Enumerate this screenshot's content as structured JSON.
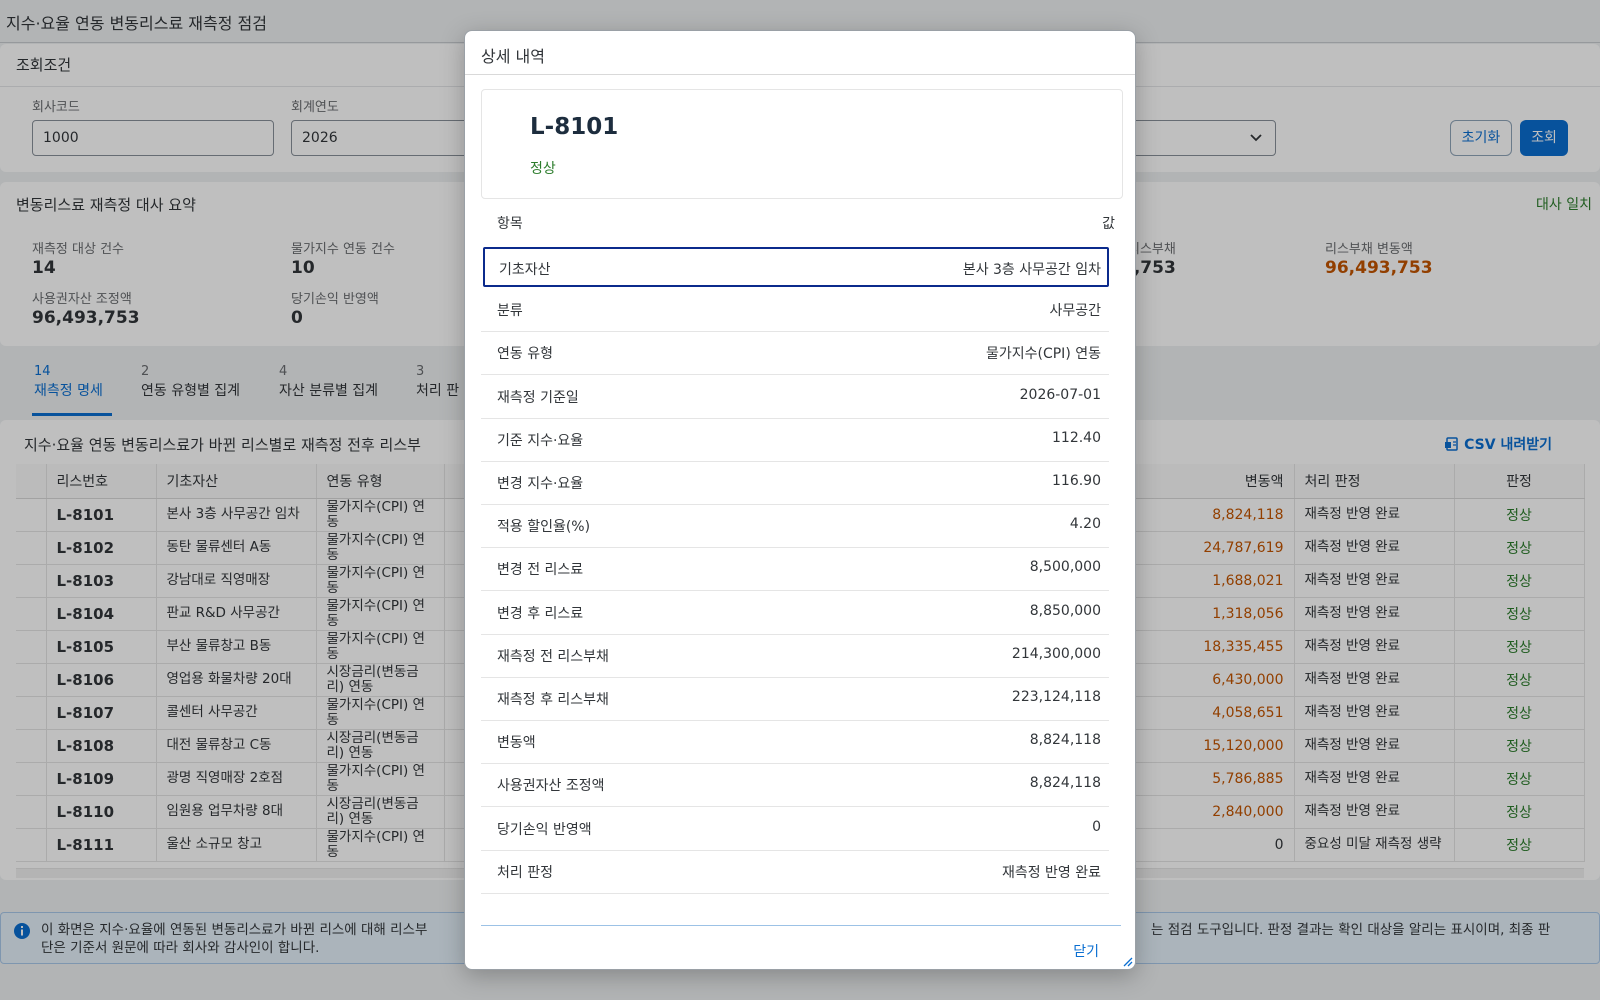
{
  "page": {
    "title": "지수·요율 연동 변동리스료 재측정 점검"
  },
  "filters": {
    "heading": "조회조건",
    "company_code_label": "회사코드",
    "company_code_value": "1000",
    "fiscal_year_label": "회계연도",
    "fiscal_year_value": "2026",
    "reset_label": "초기화",
    "search_label": "조회"
  },
  "summary": {
    "heading": "변동리스료 재측정 대사 요약",
    "status": "대사 일치",
    "kpis": [
      {
        "label": "재측정 대상 건수",
        "value": "14"
      },
      {
        "label": "물가지수 연동 건수",
        "value": "10"
      },
      {
        "label": "리스부채",
        "value": "3,753"
      },
      {
        "label": "리스부채 변동액",
        "value": "96,493,753"
      },
      {
        "label": "사용권자산 조정액",
        "value": "96,493,753"
      },
      {
        "label": "당기손익 반영액",
        "value": "0"
      }
    ],
    "accent_color": "#c35500"
  },
  "tabs": [
    {
      "count": "14",
      "label": "재측정 명세"
    },
    {
      "count": "2",
      "label": "연동 유형별 집계"
    },
    {
      "count": "4",
      "label": "자산 분류별 집계"
    },
    {
      "count": "3",
      "label": "처리 판"
    }
  ],
  "table": {
    "caption": "지수·요율 연동 변동리스료가 바뀐 리스별로 재측정 전후 리스부",
    "csv_label": "CSV 내려받기",
    "columns": [
      "리스번호",
      "기초자산",
      "연동 유형",
      "변동액",
      "처리 판정",
      "판정"
    ],
    "rows": [
      {
        "lease": "L-8101",
        "asset": "본사 3층 사무공간 임차",
        "type": "물가지수(CPI) 연동",
        "change": "8,824,118",
        "decision": "재측정 반영 완료",
        "verdict": "정상"
      },
      {
        "lease": "L-8102",
        "asset": "동탄 물류센터 A동",
        "type": "물가지수(CPI) 연동",
        "change": "24,787,619",
        "decision": "재측정 반영 완료",
        "verdict": "정상"
      },
      {
        "lease": "L-8103",
        "asset": "강남대로 직영매장",
        "type": "물가지수(CPI) 연동",
        "change": "1,688,021",
        "decision": "재측정 반영 완료",
        "verdict": "정상"
      },
      {
        "lease": "L-8104",
        "asset": "판교 R&D 사무공간",
        "type": "물가지수(CPI) 연동",
        "change": "1,318,056",
        "decision": "재측정 반영 완료",
        "verdict": "정상"
      },
      {
        "lease": "L-8105",
        "asset": "부산 물류창고 B동",
        "type": "물가지수(CPI) 연동",
        "change": "18,335,455",
        "decision": "재측정 반영 완료",
        "verdict": "정상"
      },
      {
        "lease": "L-8106",
        "asset": "영업용 화물차량 20대",
        "type": "시장금리(변동금리) 연동",
        "change": "6,430,000",
        "decision": "재측정 반영 완료",
        "verdict": "정상"
      },
      {
        "lease": "L-8107",
        "asset": "콜센터 사무공간",
        "type": "물가지수(CPI) 연동",
        "change": "4,058,651",
        "decision": "재측정 반영 완료",
        "verdict": "정상"
      },
      {
        "lease": "L-8108",
        "asset": "대전 물류창고 C동",
        "type": "시장금리(변동금리) 연동",
        "change": "15,120,000",
        "decision": "재측정 반영 완료",
        "verdict": "정상"
      },
      {
        "lease": "L-8109",
        "asset": "광명 직영매장 2호점",
        "type": "물가지수(CPI) 연동",
        "change": "5,786,885",
        "decision": "재측정 반영 완료",
        "verdict": "정상"
      },
      {
        "lease": "L-8110",
        "asset": "임원용 업무차량 8대",
        "type": "시장금리(변동금리) 연동",
        "change": "2,840,000",
        "decision": "재측정 반영 완료",
        "verdict": "정상"
      },
      {
        "lease": "L-8111",
        "asset": "울산 소규모 창고",
        "type": "물가지수(CPI) 연동",
        "change": "0",
        "decision": "중요성 미달 재측정 생략",
        "verdict": "정상"
      }
    ]
  },
  "info": {
    "text_left": "이 화면은 지수·요율에 연동된 변동리스료가 바뀐 리스에 대해 리스부",
    "text_right": "는 점검 도구입니다. 판정 결과는 확인 대상을 알리는 표시이며, 최종 판",
    "text_line2": "단은 기준서 원문에 따라 회사와 감사인이 합니다."
  },
  "dialog": {
    "title": "상세 내역",
    "lease_no": "L-8101",
    "status": "정상",
    "head_key": "항목",
    "head_val": "값",
    "rows": [
      {
        "key": "기초자산",
        "value": "본사 3층 사무공간 임차"
      },
      {
        "key": "분류",
        "value": "사무공간"
      },
      {
        "key": "연동 유형",
        "value": "물가지수(CPI) 연동"
      },
      {
        "key": "재측정 기준일",
        "value": "2026-07-01"
      },
      {
        "key": "기준 지수·요율",
        "value": "112.40"
      },
      {
        "key": "변경 지수·요율",
        "value": "116.90"
      },
      {
        "key": "적용 할인율(%)",
        "value": "4.20"
      },
      {
        "key": "변경 전 리스료",
        "value": "8,500,000"
      },
      {
        "key": "변경 후 리스료",
        "value": "8,850,000"
      },
      {
        "key": "재측정 전 리스부채",
        "value": "214,300,000"
      },
      {
        "key": "재측정 후 리스부채",
        "value": "223,124,118"
      },
      {
        "key": "변동액",
        "value": "8,824,118"
      },
      {
        "key": "사용권자산 조정액",
        "value": "8,824,118"
      },
      {
        "key": "당기손익 반영액",
        "value": "0"
      },
      {
        "key": "처리 판정",
        "value": "재측정 반영 완료"
      }
    ],
    "close_label": "닫기"
  }
}
